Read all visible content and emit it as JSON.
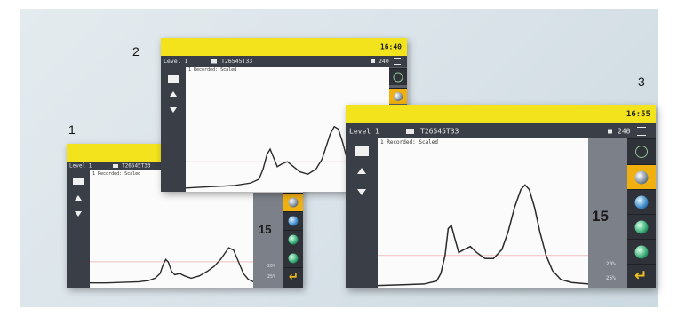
{
  "labels": {
    "one": "1",
    "two": "2",
    "three": "3"
  },
  "screen1": {
    "level": "Level 1",
    "serial": "T26545T33",
    "graph_title": "1 Recorded: Scaled",
    "value": "15",
    "unit_top": "20%",
    "unit_bottom": "25%"
  },
  "screen2": {
    "time": "16:40",
    "level": "Level 1",
    "serial": "T26545T33",
    "right_value": "240",
    "graph_title": "1 Recorded: Scaled"
  },
  "screen3": {
    "time": "16:55",
    "level": "Level 1",
    "serial": "T26545T33",
    "right_value": "240",
    "graph_title": "1 Recorded: Scaled",
    "value": "15",
    "unit_top": "20%",
    "unit_bottom": "25%"
  },
  "colors": {
    "yellow_bar": "#f2e31c",
    "status_bar": "#3a3f47",
    "curve": "#2a2a2a",
    "threshold_line": "#e8a0a0",
    "highlight": "#f0b010"
  },
  "icons": {
    "grid": "grid-icon",
    "up": "arrow-up-icon",
    "down": "arrow-down-icon",
    "target": "target-icon",
    "back": "back-arrow-icon",
    "tank": "tank-icon",
    "sphere": "sphere-icon"
  }
}
